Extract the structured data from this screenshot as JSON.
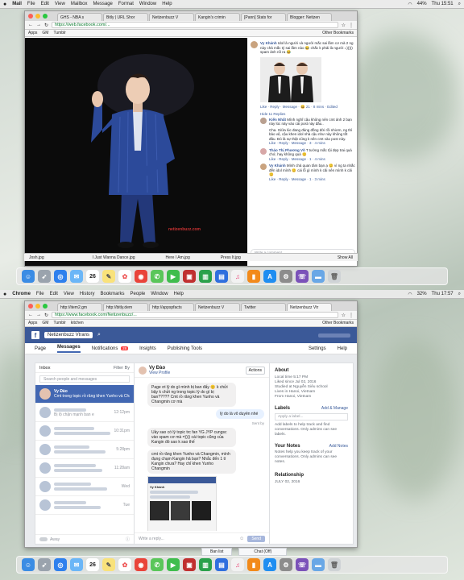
{
  "top": {
    "menubar": {
      "app": "Mail",
      "items": [
        "File",
        "Edit",
        "View",
        "Mailbox",
        "Message",
        "Format",
        "Window",
        "Help"
      ],
      "battery": "44%",
      "clock": "Thu 15:51"
    },
    "tabs": [
      "GHS - NBA s",
      "Bitly | URL Shor",
      "Netizenbuzz V",
      "Kangin's crimin",
      "[Pann] Stats for",
      "Blogger: Netizen",
      "Netizenbuzz V"
    ],
    "url": "https://web.facebook.com/...",
    "bookmarks": [
      "Apps",
      "GM",
      "Tumblr"
    ],
    "other_bookmarks": "Other Bookmarks",
    "watermark": "netizenbuzz.com",
    "comments": {
      "first_author": "Vy Khánh",
      "first_text": "Idol là người và người mắc sai lầm cơ mà 2 ng này chả mắc tý sai lầm nào 😂 chắc k phải là người =))))) spam ảnh nồ ra 😂",
      "first_meta": "Like · Reply · Message · 😆 21 · 8 mins · Edited",
      "hide_replies": "Hide 11 Replies",
      "reply1_author": "Kiến Nhất",
      "reply1_text": "Mình nghĩ cậu không nên cmt ảnh 2 bạn này lúc này vào cái post này đâu..",
      "reply1_text2": "Cha. Giữa lúc đang đúng đồng đời rồi nhiơm, ng thì bảo vệ, cậu khen idol nhà cậu như này không tốt đâu. Đó là sự thật cũng k nên cmt vào post này.",
      "reply1_meta": "Like · Reply · Message · 3 · 4 mins",
      "reply2_author": "Thảo Thị Phương Võ",
      "reply2_text": "T tường mắc tội đẹp trai quá chớ, hay không quá 😊",
      "reply2_meta": "Like · Reply · Message · 1 · 4 mins",
      "reply3_author": "Vy Khánh",
      "reply3_text": "Mình chả quan tâm bạn ạ 😊 vì ng ta nhắc đến idol mình 😊 cái lỗ gì mình k cãi nên mình k cãi 😊",
      "reply3_meta": "Like · Reply · Message · 1 · 3 mins",
      "write_placeholder": "Write a comment..."
    },
    "downloads": [
      "Josh.jpg",
      "I Just Wanna Dance.jpg",
      "Here I Am.jpg",
      "Press It.jpg"
    ],
    "show_all": "Show All",
    "dock_date": "26"
  },
  "bottom": {
    "menubar": {
      "app": "Chrome",
      "items": [
        "File",
        "Edit",
        "View",
        "History",
        "Bookmarks",
        "People",
        "Window",
        "Help"
      ],
      "battery": "32%",
      "clock": "Thu 17:57"
    },
    "tabs": [
      "http://item2.gm",
      "http://bitly.dem",
      "http://appspfacts",
      "Netizenbuzz V",
      "Twitter",
      "Netizenbuzz Vtr"
    ],
    "url": "https://www.facebook.com/Netizenbuzz/...",
    "bookmarks": [
      "Apps",
      "GM",
      "Tumblr",
      "kitchen"
    ],
    "other_bookmarks": "Other Bookmarks",
    "page_name": "Netizenbuzz Vtrans",
    "nav": [
      "Page",
      "Messages",
      "Notifications",
      "Insights",
      "Publishing Tools"
    ],
    "notif_badge": "28",
    "settings": "Settings",
    "help": "Help",
    "inbox": {
      "label": "Inbox",
      "filter": "Filter By",
      "search_placeholder": "Search people and messages",
      "selected_name": "Vy Đào",
      "selected_preview": "Cmt trong topic rồ răng khen Yunho và Cha...",
      "times": [
        "12:12pm",
        "10:31pm",
        "5:28pm",
        "11:28am",
        "Wed",
        "Tue"
      ],
      "snippet1": "Bị lộ chặn mạnh ban e",
      "away": "Away"
    },
    "chat": {
      "name": "Vy Đào",
      "view_profile": "View Profile",
      "actions": "Actions",
      "msg1": "Page ơi lý do gì mình bị ban đấy 😊 k chửi bậy k chửi ng trong topic lý do gì bị ban????? Cmt rồ răng khen Yunho và Changmin cơ mà",
      "msg_me": "lý do là vô duyên nhé",
      "sent_by": "Sent by",
      "msg2": "Uầy sao có lý topic trc fan YG JYP cungsc vào spam cơ mà =)))) cái topic cũng của Kangin đó sao k sao thế",
      "msg3": "cmt rồ răng khen Yunho và Changmin, mình đụng chạm Kangin hả bạn? Nhắc đến 1 tí Kangin chưa? Hay chỉ khen Yunho Changmin",
      "shot_text": "Vy Khánh",
      "reply_placeholder": "Write a reply...",
      "send": "Send"
    },
    "side": {
      "about": "About",
      "local_time": "Local time 5:17 PM",
      "liked_since": "Liked since Jul 02, 2016",
      "studied": "Studied at Nguyễn Siêu school",
      "lives": "Lives in Hanoi, Vietnam",
      "from": "From Hanoi, Vietnam",
      "labels": "Labels",
      "add_manage": "Add & Manage",
      "label_placeholder": "Apply a label...",
      "labels_desc": "Add labels to help track and find conversations. Only admins can see labels.",
      "notes": "Your Notes",
      "add_notes": "Add Notes",
      "notes_desc": "Notes help you keep track of your conversations. Only admins can see notes.",
      "relationship": "Relationship",
      "rel_date": "JULY 02, 2016"
    },
    "bottom_tabs": [
      "Ban list",
      "Chat (Off)"
    ],
    "dock_date": "26"
  }
}
